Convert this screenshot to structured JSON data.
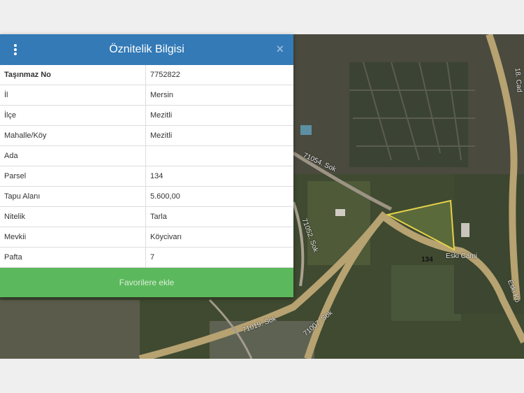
{
  "panel": {
    "title": "Öznitelik Bilgisi",
    "close_label": "×",
    "rows": [
      {
        "key": "Taşınmaz No",
        "value": "7752822"
      },
      {
        "key": "İl",
        "value": "Mersin"
      },
      {
        "key": "İlçe",
        "value": "Mezitli"
      },
      {
        "key": "Mahalle/Köy",
        "value": "Mezitli"
      },
      {
        "key": "Ada",
        "value": ""
      },
      {
        "key": "Parsel",
        "value": "134"
      },
      {
        "key": "Tapu Alanı",
        "value": "5.600,00"
      },
      {
        "key": "Nitelik",
        "value": "Tarla"
      },
      {
        "key": "Mevkii",
        "value": "Köycivarı"
      },
      {
        "key": "Pafta",
        "value": "7"
      }
    ],
    "favorite_button": "Favorilere ekle"
  },
  "map": {
    "parcel_label": "134",
    "roads": [
      "18. Cad",
      "71054. Sok",
      "71052. Sok",
      "71019. Sok",
      "71007. Sok",
      "Eski Kö",
      "Eski Cami"
    ]
  },
  "colors": {
    "header": "#337ab7",
    "favorite": "#5cb85c",
    "parcel_outline": "#e6d24a"
  }
}
